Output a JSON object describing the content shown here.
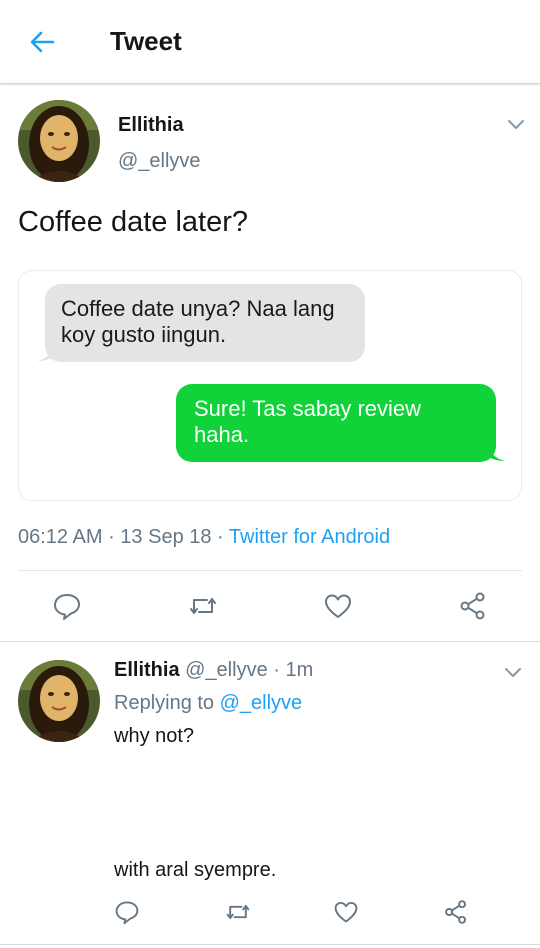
{
  "header": {
    "title": "Tweet"
  },
  "tweet": {
    "author_name": "Ellithia",
    "author_handle": "@_ellyve",
    "text": "Coffee date later?",
    "media": {
      "received_message": "Coffee date unya? Naa lang koy gusto iingun.",
      "sent_message": "Sure! Tas sabay review haha."
    },
    "time": "06:12 AM",
    "sep1": " · ",
    "date": "13 Sep 18",
    "sep2": " · ",
    "source": "Twitter for Android"
  },
  "reply": {
    "author_name": "Ellithia",
    "handle_and_time": " @_ellyve · 1m",
    "replying_prefix": "Replying to ",
    "replying_handle": "@_ellyve",
    "line1": "why not?",
    "line2": "with aral syempre."
  },
  "icons": [
    "back-arrow-icon",
    "chevron-down-icon",
    "reply-icon",
    "retweet-icon",
    "like-icon",
    "share-icon"
  ],
  "colors": {
    "accent": "#1da1f2",
    "secondary_text": "#657786",
    "sent_bubble": "#10d33a",
    "received_bubble": "#e3e4e6"
  }
}
